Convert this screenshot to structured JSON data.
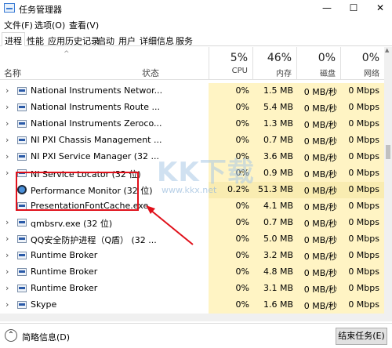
{
  "window": {
    "title": "任务管理器",
    "controls": {
      "minimize": "—",
      "maximize": "☐",
      "close": "✕"
    }
  },
  "menu": [
    "文件(F)",
    "选项(O)",
    "查看(V)"
  ],
  "tabs": [
    "进程",
    "性能",
    "应用历史记录",
    "启动",
    "用户",
    "详细信息",
    "服务"
  ],
  "active_tab": "进程",
  "header": {
    "sort_caret": "^",
    "name": "名称",
    "status": "状态",
    "cpu": {
      "percent": "5%",
      "label": "CPU"
    },
    "memory": {
      "percent": "46%",
      "label": "内存"
    },
    "disk": {
      "percent": "0%",
      "label": "磁盘"
    },
    "network": {
      "percent": "0%",
      "label": "网络"
    }
  },
  "processes": [
    {
      "name": "National Instruments Networ...",
      "cpu": "0%",
      "memory": "1.5 MB",
      "disk": "0 MB/秒",
      "network": "0 Mbps",
      "icon": "service-icon"
    },
    {
      "name": "National Instruments Route ...",
      "cpu": "0%",
      "memory": "5.4 MB",
      "disk": "0 MB/秒",
      "network": "0 Mbps",
      "icon": "service-icon"
    },
    {
      "name": "National Instruments Zeroco...",
      "cpu": "0%",
      "memory": "1.3 MB",
      "disk": "0 MB/秒",
      "network": "0 Mbps",
      "icon": "service-icon"
    },
    {
      "name": "NI PXI Chassis Management ...",
      "cpu": "0%",
      "memory": "0.7 MB",
      "disk": "0 MB/秒",
      "network": "0 Mbps",
      "icon": "service-icon"
    },
    {
      "name": "NI PXI Service Manager (32 ...",
      "cpu": "0%",
      "memory": "3.6 MB",
      "disk": "0 MB/秒",
      "network": "0 Mbps",
      "icon": "service-icon"
    },
    {
      "name": "NI Service Locator (32 位)",
      "cpu": "0%",
      "memory": "0.9 MB",
      "disk": "0 MB/秒",
      "network": "0 Mbps",
      "icon": "service-icon"
    },
    {
      "name": "Performance Monitor (32 位)",
      "cpu": "0.2%",
      "memory": "51.3 MB",
      "disk": "0 MB/秒",
      "network": "0 Mbps",
      "icon": "performance-monitor-icon"
    },
    {
      "name": "PresentationFontCache.exe",
      "cpu": "0%",
      "memory": "4.1 MB",
      "disk": "0 MB/秒",
      "network": "0 Mbps",
      "icon": "service-icon"
    },
    {
      "name": "qmbsrv.exe (32 位)",
      "cpu": "0%",
      "memory": "0.7 MB",
      "disk": "0 MB/秒",
      "network": "0 Mbps",
      "icon": "service-icon"
    },
    {
      "name": "QQ安全防护进程（Q盾） (32 ...",
      "cpu": "0%",
      "memory": "5.0 MB",
      "disk": "0 MB/秒",
      "network": "0 Mbps",
      "icon": "service-icon"
    },
    {
      "name": "Runtime Broker",
      "cpu": "0%",
      "memory": "3.2 MB",
      "disk": "0 MB/秒",
      "network": "0 Mbps",
      "icon": "service-icon"
    },
    {
      "name": "Runtime Broker",
      "cpu": "0%",
      "memory": "4.8 MB",
      "disk": "0 MB/秒",
      "network": "0 Mbps",
      "icon": "service-icon"
    },
    {
      "name": "Runtime Broker",
      "cpu": "0%",
      "memory": "3.1 MB",
      "disk": "0 MB/秒",
      "network": "0 Mbps",
      "icon": "service-icon"
    },
    {
      "name": "Skype",
      "cpu": "0%",
      "memory": "1.6 MB",
      "disk": "0 MB/秒",
      "network": "0 Mbps",
      "icon": "skype-icon"
    }
  ],
  "selected_index": 6,
  "watermark": {
    "text": "KK下载",
    "url": "www.kkx.net"
  },
  "footer": {
    "fewer_details": "简略信息(D)",
    "end_task": "结束任务(E)"
  },
  "colors": {
    "highlight_box": "#e0101a",
    "column_shade": "#fff4c4",
    "arrow": "#e0101a"
  }
}
